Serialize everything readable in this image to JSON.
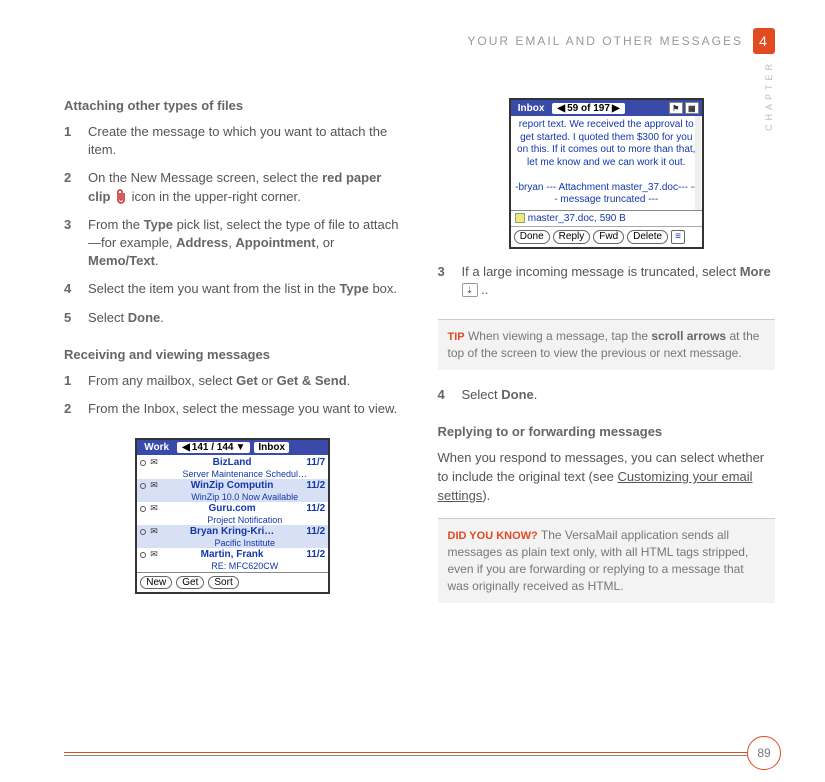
{
  "header": {
    "section_title": "YOUR EMAIL AND OTHER MESSAGES",
    "chapter_number": "4",
    "chapter_label": "CHAPTER"
  },
  "left": {
    "h1": "Attaching other types of files",
    "steps1": [
      "Create the message to which you want to attach the item.",
      "On the New Message screen, select the |red paper clip| icon in the upper-right corner.",
      "From the |Type| pick list, select the type of file to attach—for example, |Address|, |Appointment|, or |Memo/Text|.",
      "Select the item you want from the list in the |Type| box.",
      "Select |Done|."
    ],
    "h2": "Receiving and viewing messages",
    "steps2": [
      "From any mailbox, select |Get| or |Get & Send|.",
      "From the Inbox, select the message you want to view."
    ],
    "work_shot": {
      "title": "Work",
      "nav": "141 / 144",
      "dropdown": "Inbox",
      "rows": [
        {
          "sender": "BizLand",
          "date": "11/7",
          "subject": "Server Maintenance Schedul…",
          "sel": false
        },
        {
          "sender": "WinZip Computin",
          "date": "11/2",
          "subject": "WinZip 10.0 Now Available",
          "sel": true
        },
        {
          "sender": "Guru.com",
          "date": "11/2",
          "subject": "Project Notification",
          "sel": false
        },
        {
          "sender": "Bryan Kring-Kri…",
          "date": "11/2",
          "subject": "Pacific Institute",
          "sel": true
        },
        {
          "sender": "Martin, Frank",
          "date": "11/2",
          "subject": "RE: MFC620CW",
          "sel": false
        }
      ],
      "buttons": [
        "New",
        "Get",
        "Sort"
      ]
    }
  },
  "right": {
    "inbox_shot": {
      "title": "Inbox",
      "nav": "59 of 197",
      "body": "report text. We received the approval to get started. I quoted them $300 for you on this. If it comes out to more than that, let me know and we can work it out.",
      "sig": "-bryan --- Attachment master_37.doc--- --- message truncated ---",
      "attach_name": "master_37.doc,",
      "attach_size": "590 B",
      "buttons": [
        "Done",
        "Reply",
        "Fwd",
        "Delete"
      ]
    },
    "steps3": [
      "If a large incoming message is truncated, select |More|."
    ],
    "tip": {
      "label": "TIP",
      "text_a": "When viewing a message, tap the ",
      "text_b": "scroll arrows",
      "text_c": " at the top of the screen to view the previous or next message."
    },
    "step4": "Select |Done|.",
    "h3": "Replying to or forwarding messages",
    "p1_a": "When you respond to messages, you can select whether to include the original text (see ",
    "p1_link": "Customizing your email settings",
    "p1_b": ").",
    "dyk": {
      "label": "DID YOU KNOW?",
      "text": "The VersaMail application sends all messages as plain text only, with all HTML tags stripped, even if you are forwarding or replying to a message that was originally received as HTML."
    }
  },
  "footer": {
    "page": "89"
  }
}
